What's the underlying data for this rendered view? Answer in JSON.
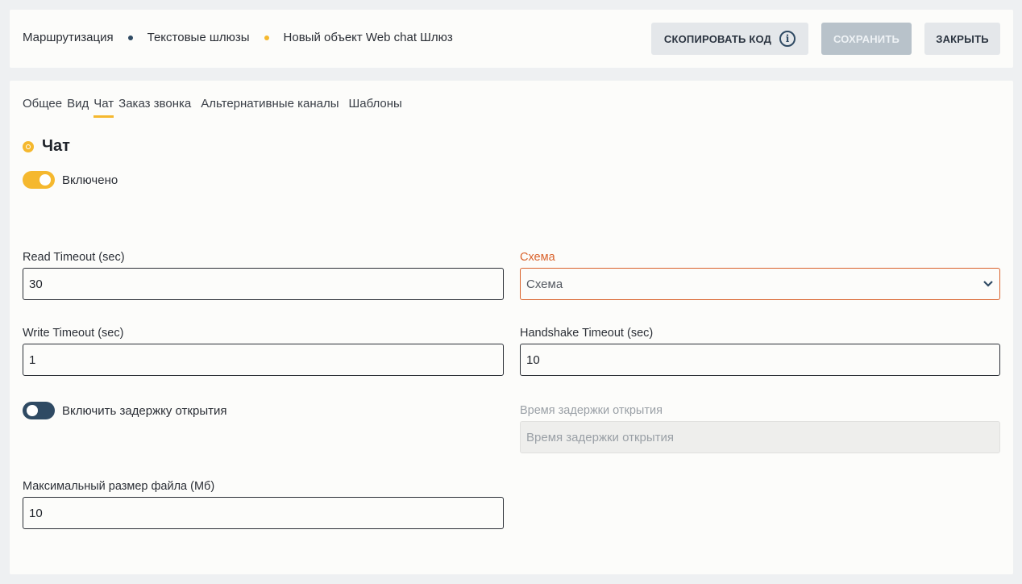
{
  "breadcrumbs": {
    "items": [
      "Маршрутизация",
      "Текстовые шлюзы",
      "Новый объект Web chat Шлюз"
    ],
    "dot_colors": [
      "#2f4a63",
      "#f5b82e"
    ]
  },
  "toolbar": {
    "copy_code": "СКОПИРОВАТЬ КОД",
    "save": "СОХРАНИТЬ",
    "close": "ЗАКРЫТЬ"
  },
  "tabs": [
    "Общее",
    "Вид",
    "Чат",
    "Заказ звонка",
    "Альтернативные каналы",
    "Шаблоны"
  ],
  "active_tab": "Чат",
  "section": {
    "title": "Чат"
  },
  "chat_enabled": {
    "label": "Включено",
    "state": "on"
  },
  "read_timeout": {
    "label": "Read Timeout (sec)",
    "value": "30"
  },
  "schema": {
    "label": "Схема",
    "value": "Схема"
  },
  "write_timeout": {
    "label": "Write Timeout (sec)",
    "value": "1"
  },
  "handshake_timeout": {
    "label": "Handshake Timeout (sec)",
    "value": "10"
  },
  "open_delay_toggle": {
    "label": "Включить задержку открытия",
    "state": "off"
  },
  "open_delay_time": {
    "label": "Время задержки открытия",
    "placeholder": "Время задержки открытия"
  },
  "max_file_size": {
    "label": "Максимальный размер файла (Мб)",
    "value": "10"
  },
  "colors": {
    "accent": "#f5b82e",
    "dark": "#2f4a63",
    "error": "#d9622b"
  }
}
